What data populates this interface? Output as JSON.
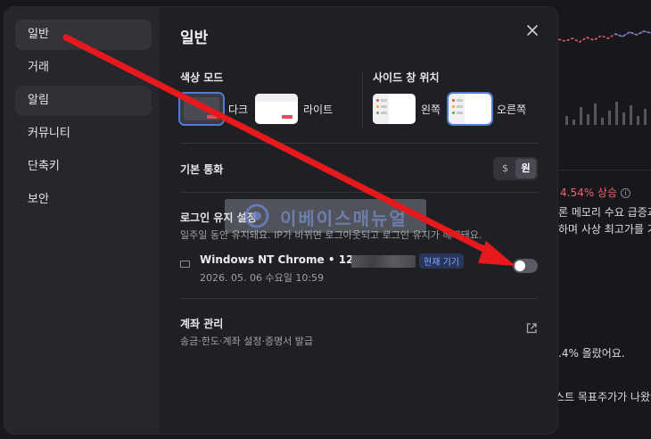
{
  "background": {
    "change_text": "4.54% 상승",
    "line1": "론 메모리 수요 급증과",
    "line2": "하며 사상 최고가를 기",
    "line3": ".4% 올랐어요.",
    "line4": "스트 목표주가가 나왔어"
  },
  "sidebar": {
    "items": [
      {
        "label": "일반"
      },
      {
        "label": "거래"
      },
      {
        "label": "알림"
      },
      {
        "label": "커뮤니티"
      },
      {
        "label": "단축키"
      },
      {
        "label": "보안"
      }
    ]
  },
  "main": {
    "title": "일반",
    "color_mode": {
      "label": "색상 모드",
      "options": [
        {
          "label": "다크",
          "selected": true
        },
        {
          "label": "라이트",
          "selected": false
        }
      ]
    },
    "side_window": {
      "label": "사이드 창 위치",
      "options": [
        {
          "label": "왼쪽",
          "selected": false
        },
        {
          "label": "오른쪽",
          "selected": true
        }
      ]
    },
    "currency": {
      "label": "기본 통화",
      "options": [
        "$",
        "원"
      ],
      "selected": "원"
    },
    "login": {
      "label": "로그인 유지 설정",
      "desc": "일주일 동안 유지돼요. IP가 바뀌면 로그아웃되고 로그인 유지가 해제돼요.",
      "device_name": "Windows NT Chrome • 121",
      "badge": "현재 기기",
      "device_time": "2026. 05. 06 수요일 10:59",
      "toggle_on": false
    },
    "account": {
      "label": "계좌 관리",
      "desc": "송금·한도·계좌 설정·증명서 발급"
    }
  },
  "watermark": {
    "text": "이베이스매뉴얼"
  },
  "colors": {
    "accent": "#4e7bd6",
    "arrow": "#e8191c",
    "up": "#f0616d"
  }
}
